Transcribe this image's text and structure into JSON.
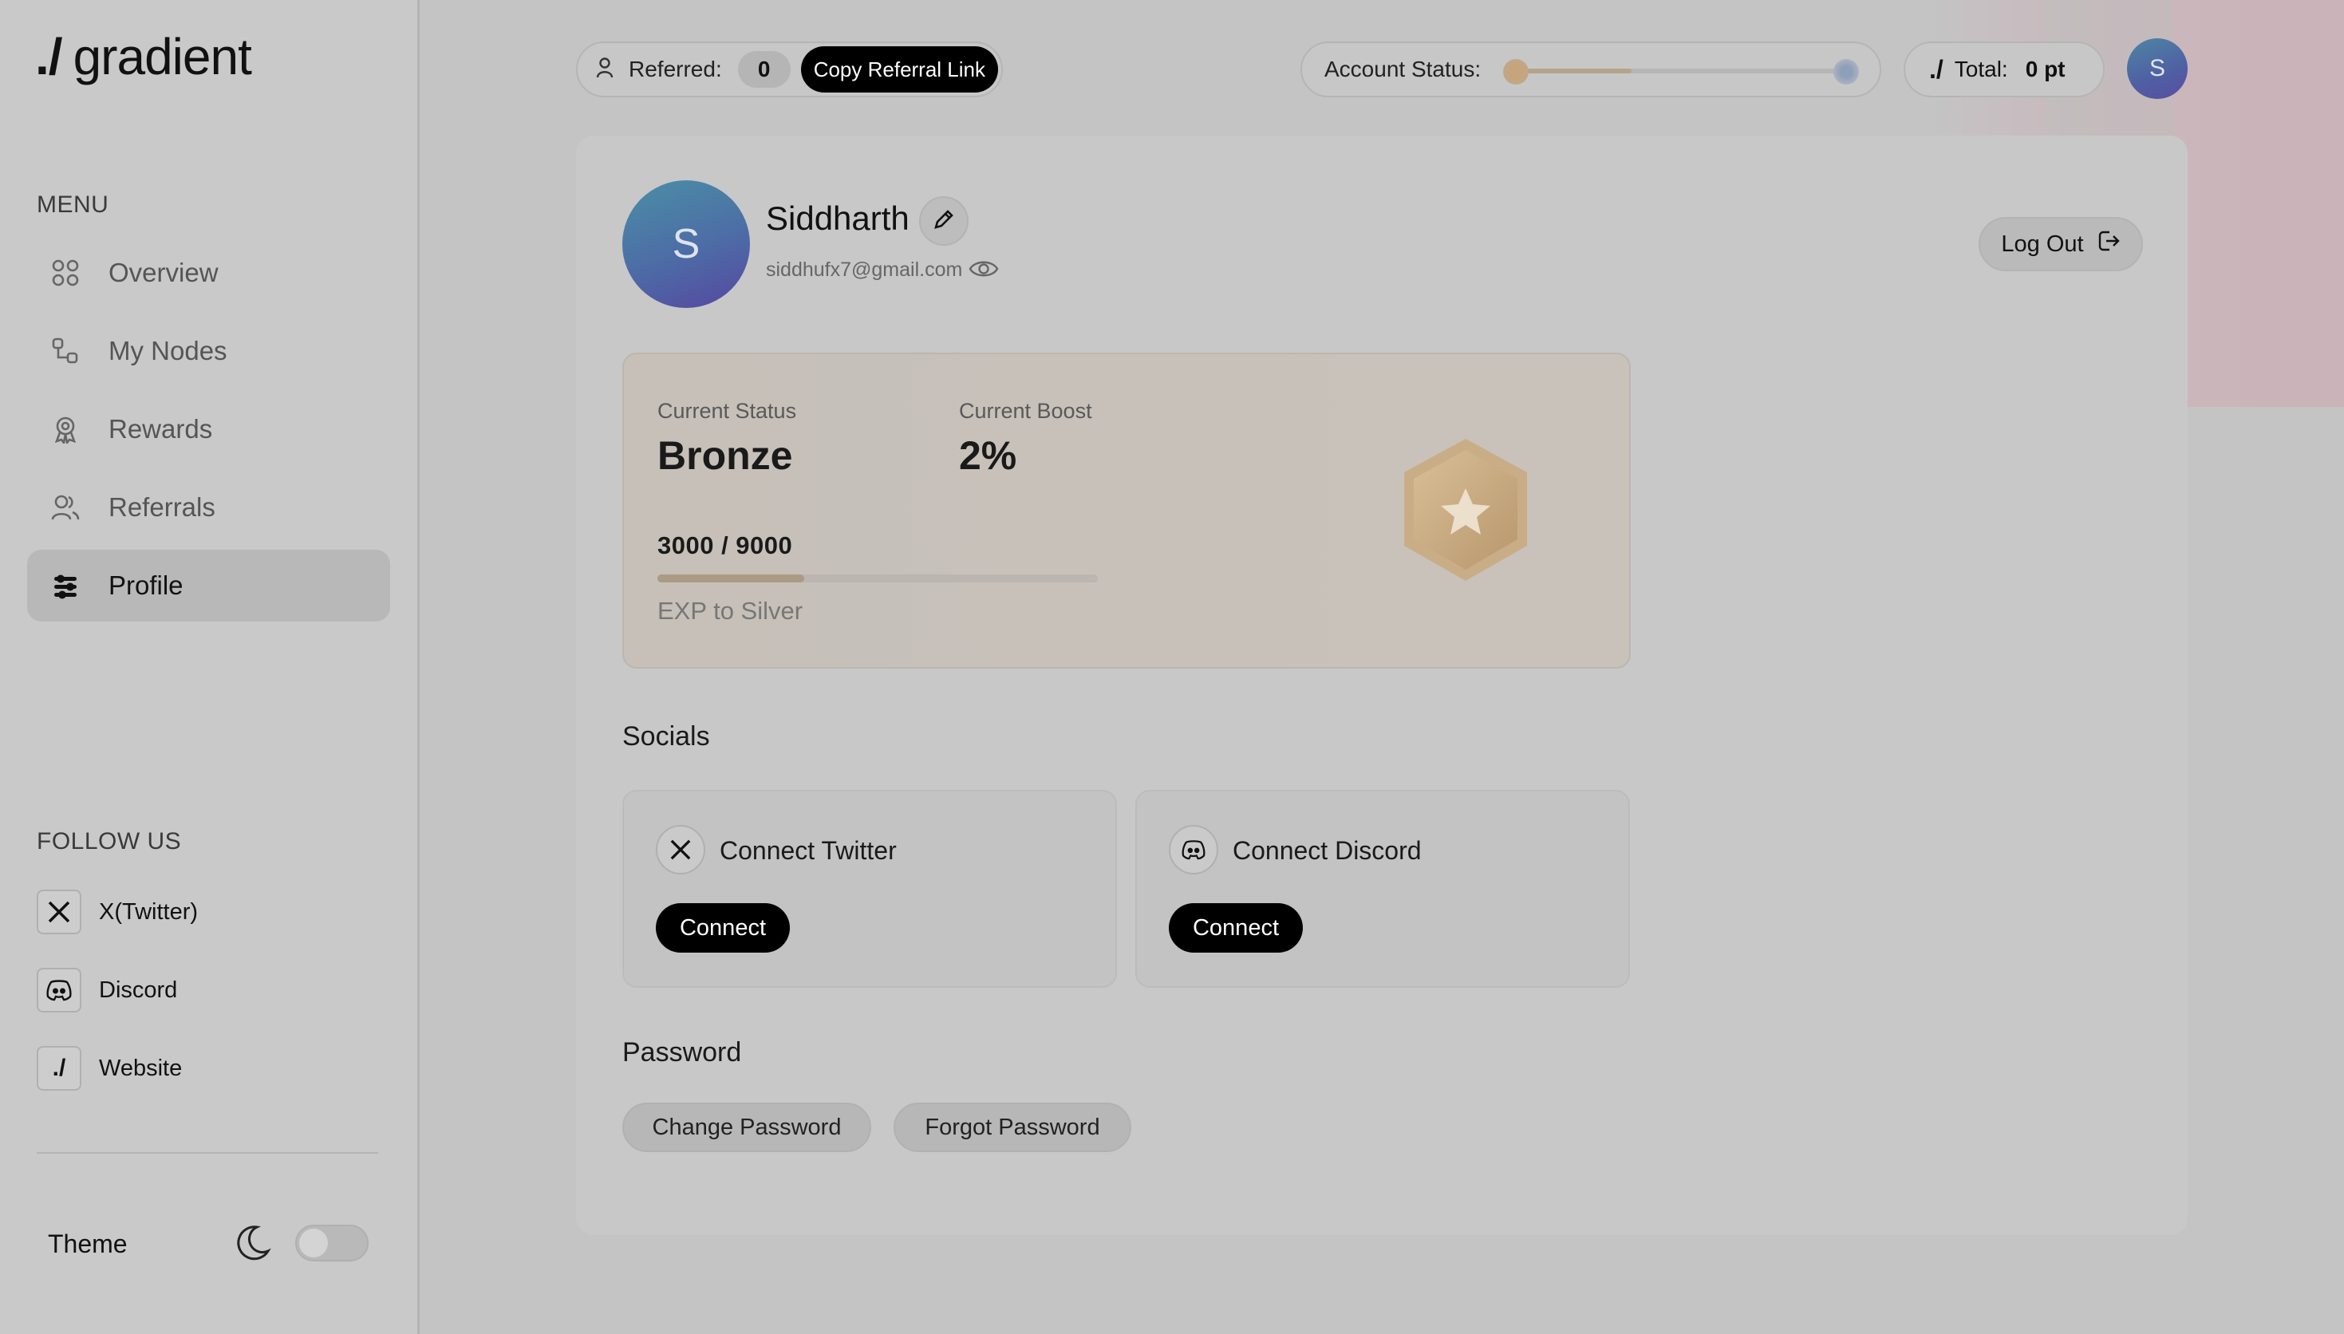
{
  "brand": {
    "slash": "./",
    "name": "gradient"
  },
  "sidebar": {
    "menu_label": "MENU",
    "items": [
      {
        "label": "Overview",
        "icon": "grid-icon"
      },
      {
        "label": "My Nodes",
        "icon": "nodes-icon"
      },
      {
        "label": "Rewards",
        "icon": "award-icon"
      },
      {
        "label": "Referrals",
        "icon": "users-icon"
      },
      {
        "label": "Profile",
        "icon": "profile-icon",
        "active": true
      }
    ],
    "follow_label": "FOLLOW US",
    "follow": [
      {
        "label": "X(Twitter)",
        "icon": "x-icon"
      },
      {
        "label": "Discord",
        "icon": "discord-icon"
      },
      {
        "label": "Website",
        "icon": "website-icon"
      }
    ],
    "theme_label": "Theme"
  },
  "topbar": {
    "referred_label": "Referred:",
    "referred_count": "0",
    "copy_referral": "Copy Referral Link",
    "account_status_label": "Account Status:",
    "account_progress": 0.36,
    "total_slash": "./",
    "total_label": "Total:",
    "total_value": "0 pt",
    "avatar_initial": "S"
  },
  "profile": {
    "avatar_initial": "S",
    "name": "Siddharth",
    "email": "siddhufx7@gmail.com",
    "logout": "Log Out"
  },
  "status": {
    "current_status_label": "Current Status",
    "current_status": "Bronze",
    "current_boost_label": "Current Boost",
    "current_boost": "2%",
    "progress_text": "3000 / 9000",
    "progress": 0.333,
    "exp_label": "EXP to Silver"
  },
  "socials": {
    "heading": "Socials",
    "twitter_title": "Connect Twitter",
    "discord_title": "Connect Discord",
    "connect_label": "Connect"
  },
  "password": {
    "heading": "Password",
    "change": "Change Password",
    "forgot": "Forgot Password"
  },
  "colors": {
    "accent_dark": "#000000",
    "bronze": "#c7a47a",
    "silver": "#8e9fb8",
    "avatar_gradient_start": "#4a8fa6",
    "avatar_gradient_end": "#5548a0"
  }
}
